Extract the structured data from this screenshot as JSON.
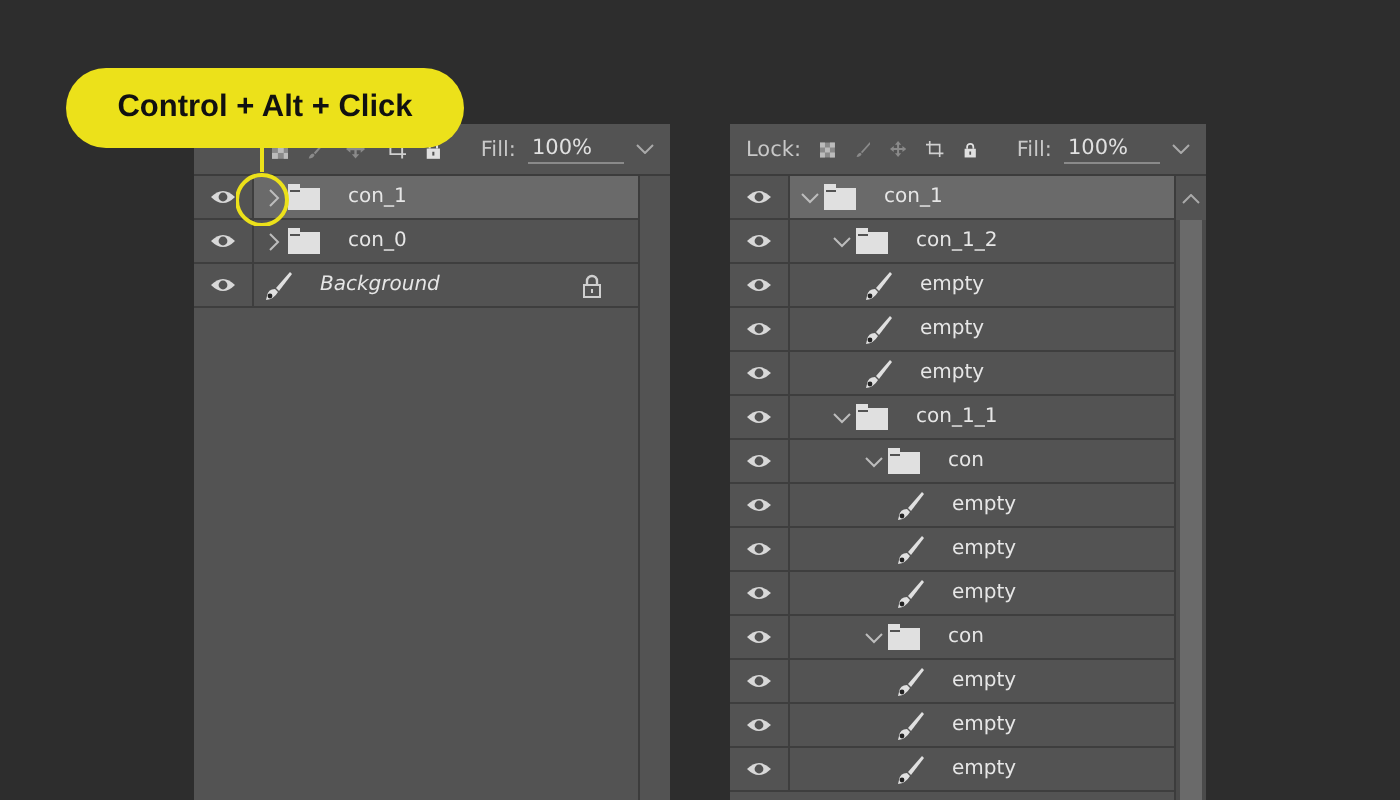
{
  "callout": {
    "label": "Control + Alt + Click"
  },
  "panels": [
    {
      "fill_label": "Fill:",
      "fill_value": "100%",
      "layers": [
        {
          "kind": "group",
          "name": "con_1",
          "selected": true,
          "expanded": false
        },
        {
          "kind": "group",
          "name": "con_0",
          "selected": false,
          "expanded": false
        },
        {
          "kind": "background",
          "name": "Background",
          "selected": false,
          "locked": true
        }
      ]
    },
    {
      "lock_label": "Lock:",
      "fill_label": "Fill:",
      "fill_value": "100%",
      "layers": [
        {
          "kind": "group",
          "name": "con_1",
          "selected": true,
          "expanded": true,
          "children": [
            {
              "kind": "group",
              "name": "con_1_2",
              "selected": false,
              "expanded": true,
              "children": [
                {
                  "kind": "layer",
                  "name": "empty",
                  "selected": false
                },
                {
                  "kind": "layer",
                  "name": "empty",
                  "selected": false
                },
                {
                  "kind": "layer",
                  "name": "empty",
                  "selected": false
                }
              ]
            },
            {
              "kind": "group",
              "name": "con_1_1",
              "selected": false,
              "expanded": true,
              "children": [
                {
                  "kind": "group",
                  "name": "con",
                  "selected": false,
                  "expanded": true,
                  "children": [
                    {
                      "kind": "layer",
                      "name": "empty",
                      "selected": false
                    },
                    {
                      "kind": "layer",
                      "name": "empty",
                      "selected": false
                    },
                    {
                      "kind": "layer",
                      "name": "empty",
                      "selected": false
                    }
                  ]
                },
                {
                  "kind": "group",
                  "name": "con",
                  "selected": false,
                  "expanded": true,
                  "children": [
                    {
                      "kind": "layer",
                      "name": "empty",
                      "selected": false
                    },
                    {
                      "kind": "layer",
                      "name": "empty",
                      "selected": false
                    },
                    {
                      "kind": "layer",
                      "name": "empty",
                      "selected": false
                    }
                  ]
                }
              ]
            }
          ]
        }
      ]
    }
  ]
}
